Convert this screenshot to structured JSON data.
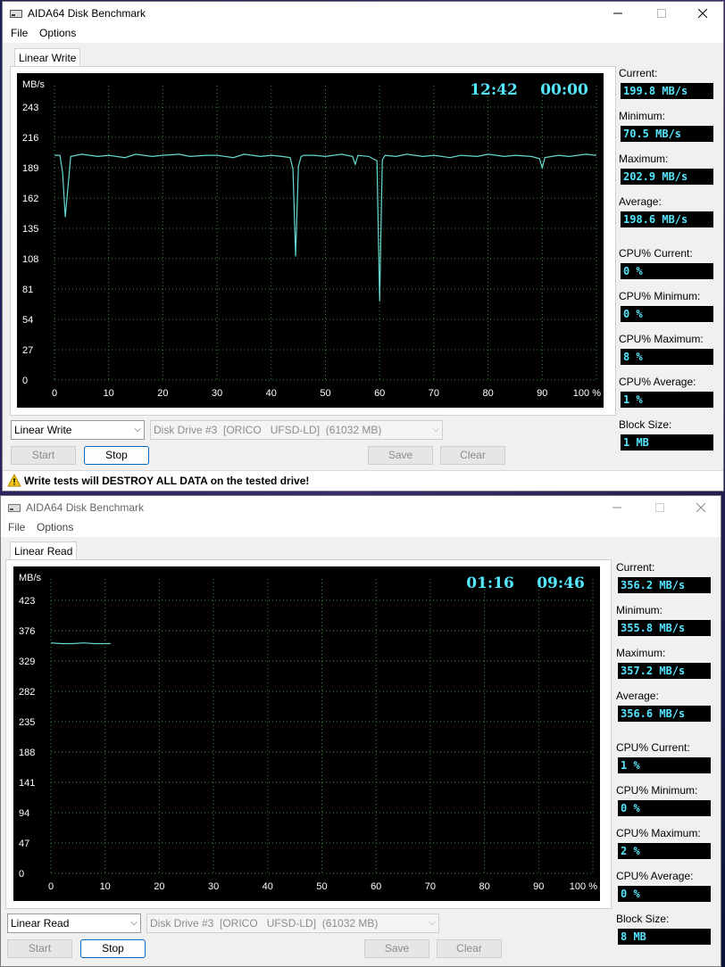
{
  "windows": [
    {
      "title": "AIDA64 Disk Benchmark",
      "menu": [
        "File",
        "Options"
      ],
      "tab_label": "Linear Write",
      "chart": {
        "unit_label": "MB/s",
        "elapsed": "12:42",
        "remaining": "00:00",
        "y_ticks": [
          "243",
          "216",
          "189",
          "162",
          "135",
          "108",
          "81",
          "54",
          "27",
          "0"
        ],
        "x_ticks": [
          "0",
          "10",
          "20",
          "30",
          "40",
          "50",
          "60",
          "70",
          "80",
          "90",
          "100 %"
        ]
      },
      "stats": [
        {
          "label": "Current:",
          "value": "199.8 MB/s"
        },
        {
          "label": "Minimum:",
          "value": "70.5 MB/s"
        },
        {
          "label": "Maximum:",
          "value": "202.9 MB/s"
        },
        {
          "label": "Average:",
          "value": "198.6 MB/s"
        },
        {
          "label": "CPU% Current:",
          "value": "0 %"
        },
        {
          "label": "CPU% Minimum:",
          "value": "0 %"
        },
        {
          "label": "CPU% Maximum:",
          "value": "8 %"
        },
        {
          "label": "CPU% Average:",
          "value": "1 %"
        },
        {
          "label": "Block Size:",
          "value": "1 MB"
        }
      ],
      "test_select": "Linear Write",
      "drive_select": "Disk Drive #3  [ORICO   UFSD-LD]  (61032 MB)",
      "buttons": {
        "start": "Start",
        "stop": "Stop",
        "save": "Save",
        "clear": "Clear"
      },
      "warning": "Write tests will DESTROY ALL DATA on the tested drive!"
    },
    {
      "title": "AIDA64 Disk Benchmark",
      "menu": [
        "File",
        "Options"
      ],
      "tab_label": "Linear Read",
      "chart": {
        "unit_label": "MB/s",
        "elapsed": "01:16",
        "remaining": "09:46",
        "y_ticks": [
          "423",
          "376",
          "329",
          "282",
          "235",
          "188",
          "141",
          "94",
          "47",
          "0"
        ],
        "x_ticks": [
          "0",
          "10",
          "20",
          "30",
          "40",
          "50",
          "60",
          "70",
          "80",
          "90",
          "100 %"
        ]
      },
      "stats": [
        {
          "label": "Current:",
          "value": "356.2 MB/s"
        },
        {
          "label": "Minimum:",
          "value": "355.8 MB/s"
        },
        {
          "label": "Maximum:",
          "value": "357.2 MB/s"
        },
        {
          "label": "Average:",
          "value": "356.6 MB/s"
        },
        {
          "label": "CPU% Current:",
          "value": "1 %"
        },
        {
          "label": "CPU% Minimum:",
          "value": "0 %"
        },
        {
          "label": "CPU% Maximum:",
          "value": "2 %"
        },
        {
          "label": "CPU% Average:",
          "value": "0 %"
        },
        {
          "label": "Block Size:",
          "value": "8 MB"
        }
      ],
      "test_select": "Linear Read",
      "drive_select": "Disk Drive #3  [ORICO   UFSD-LD]  (61032 MB)",
      "buttons": {
        "start": "Start",
        "stop": "Stop",
        "save": "Save",
        "clear": "Clear"
      }
    }
  ],
  "chart_data": [
    {
      "type": "line",
      "ylabel": "MB/s",
      "ylim": [
        0,
        270
      ],
      "xlim": [
        0,
        100
      ],
      "grid": true,
      "series": [
        {
          "color": "#66d9d0",
          "x": [
            0,
            1,
            1.5,
            2,
            3,
            5,
            8,
            10,
            13,
            15,
            18,
            20,
            23,
            25,
            28,
            30,
            33,
            35,
            38,
            40,
            42,
            43.5,
            44,
            44.5,
            45,
            45.5,
            46,
            48,
            50,
            53,
            55,
            55.5,
            56,
            58,
            59.5,
            60,
            60.5,
            61,
            63,
            65,
            68,
            70,
            73,
            75,
            78,
            80,
            83,
            85,
            88,
            89.5,
            90,
            90.5,
            93,
            95,
            98,
            100
          ],
          "y": [
            200,
            200,
            185,
            145,
            199,
            201,
            199,
            200,
            198,
            201,
            199,
            200,
            201,
            199,
            200,
            200,
            198,
            201,
            199,
            200,
            199,
            198,
            188,
            110,
            190,
            199,
            200,
            200,
            199,
            201,
            199,
            192,
            200,
            199,
            195,
            70,
            196,
            200,
            199,
            201,
            199,
            200,
            198,
            200,
            199,
            201,
            199,
            200,
            199,
            197,
            189,
            198,
            200,
            199,
            201,
            200
          ]
        }
      ]
    },
    {
      "type": "line",
      "ylabel": "MB/s",
      "ylim": [
        0,
        470
      ],
      "xlim": [
        0,
        100
      ],
      "grid": true,
      "series": [
        {
          "color": "#66d9d0",
          "x": [
            0,
            2,
            4,
            6,
            8,
            10,
            11
          ],
          "y": [
            357,
            356,
            356,
            357,
            356,
            356,
            356
          ]
        }
      ]
    }
  ]
}
